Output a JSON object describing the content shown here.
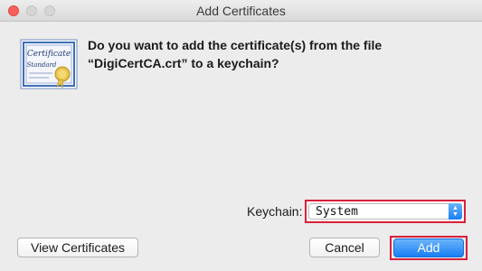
{
  "window": {
    "title": "Add Certificates"
  },
  "dialog": {
    "message_line1": "Do you want to add the certificate(s) from the file",
    "message_line2": "“DigiCertCA.crt” to a keychain?",
    "certificate_text_top": "Certificate",
    "certificate_text_bottom": "Standard"
  },
  "keychain": {
    "label": "Keychain:",
    "selected": "System"
  },
  "buttons": {
    "view_certificates": "View Certificates",
    "cancel": "Cancel",
    "add": "Add"
  },
  "colors": {
    "highlight_border": "#d8203a",
    "accent_blue": "#1a7ef5"
  },
  "icons": {
    "certificate": "certificate-icon",
    "select_arrows": "chevron-updown-icon"
  }
}
